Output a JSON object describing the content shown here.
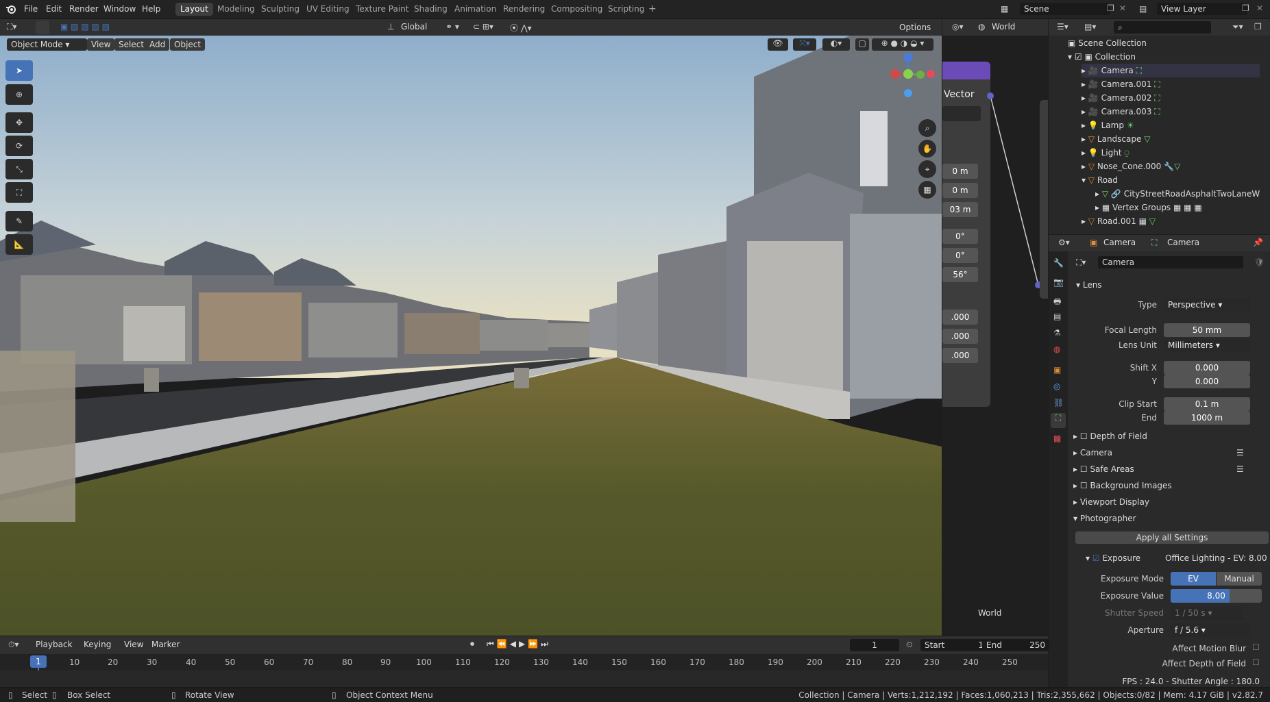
{
  "menu": [
    "File",
    "Edit",
    "Render",
    "Window",
    "Help"
  ],
  "workspaces": [
    "Layout",
    "Modeling",
    "Sculpting",
    "UV Editing",
    "Texture Paint",
    "Shading",
    "Animation",
    "Rendering",
    "Compositing",
    "Scripting"
  ],
  "active_workspace": "Layout",
  "scene_name": "Scene",
  "view_layer": "View Layer",
  "viewport": {
    "mode": "Object Mode",
    "menus": [
      "View",
      "Select",
      "Add",
      "Object"
    ],
    "transform_orientation": "Global",
    "options_label": "Options"
  },
  "node_editor": {
    "world_dropdown": "World",
    "node_title": "Vector",
    "values": [
      "0 m",
      "0 m",
      "03 m",
      "0°",
      "0°",
      "56°",
      ".000",
      ".000",
      ".000"
    ],
    "footer_label": "World"
  },
  "outliner": {
    "root": "Scene Collection",
    "collection": "Collection",
    "items": [
      "Camera",
      "Camera.001",
      "Camera.002",
      "Camera.003",
      "Lamp",
      "Landscape",
      "Light",
      "Nose_Cone.000",
      "Road"
    ],
    "road_children": [
      "CityStreetRoadAsphaltTwoLaneW",
      "Vertex Groups"
    ],
    "after": "Road.001"
  },
  "properties": {
    "breadcrumb_object": "Camera",
    "breadcrumb_data": "Camera",
    "datablock_name": "Camera",
    "lens_section": "Lens",
    "type_label": "Type",
    "type_value": "Perspective",
    "focal_length_label": "Focal Length",
    "focal_length_value": "50 mm",
    "lens_unit_label": "Lens Unit",
    "lens_unit_value": "Millimeters",
    "shift_x_label": "Shift X",
    "shift_x_value": "0.000",
    "shift_y_label": "Y",
    "shift_y_value": "0.000",
    "clip_start_label": "Clip Start",
    "clip_start_value": "0.1 m",
    "clip_end_label": "End",
    "clip_end_value": "1000 m",
    "panels": [
      "Depth of Field",
      "Camera",
      "Safe Areas",
      "Background Images",
      "Viewport Display",
      "Photographer"
    ],
    "apply_button": "Apply all Settings",
    "exposure_label": "Exposure",
    "exposure_info": "Office Lighting - EV: 8.00",
    "exposure_mode_label": "Exposure Mode",
    "exposure_mode_options": [
      "EV",
      "Manual"
    ],
    "exposure_value_label": "Exposure Value",
    "exposure_value": "8.00",
    "shutter_label": "Shutter Speed",
    "shutter_value": "1 / 50 s",
    "aperture_label": "Aperture",
    "aperture_value": "f / 5.6",
    "motion_blur_label": "Affect Motion Blur",
    "dof_label": "Affect Depth of Field",
    "fps_info": "FPS : 24.0 - Shutter Angle : 180.0"
  },
  "timeline": {
    "menus": [
      "Playback",
      "Keying",
      "View",
      "Marker"
    ],
    "current_frame": "1",
    "start_label": "Start",
    "start_value": "1",
    "end_label": "End",
    "end_value": "250",
    "ticks": [
      "10",
      "20",
      "30",
      "40",
      "50",
      "60",
      "70",
      "80",
      "90",
      "100",
      "110",
      "120",
      "130",
      "140",
      "150",
      "160",
      "170",
      "180",
      "190",
      "200",
      "210",
      "220",
      "230",
      "240",
      "250"
    ],
    "playhead": "1"
  },
  "statusbar": {
    "select": "Select",
    "box_select": "Box Select",
    "rotate_view": "Rotate View",
    "context_menu": "Object Context Menu",
    "stats": "Collection | Camera | Verts:1,212,192 | Faces:1,060,213 | Tris:2,355,662 | Objects:0/82 | Mem: 4.17 GiB | v2.82.7"
  },
  "colors": {
    "accent": "#4673b8",
    "orange": "#e08a3c",
    "green": "#6fd46f"
  }
}
